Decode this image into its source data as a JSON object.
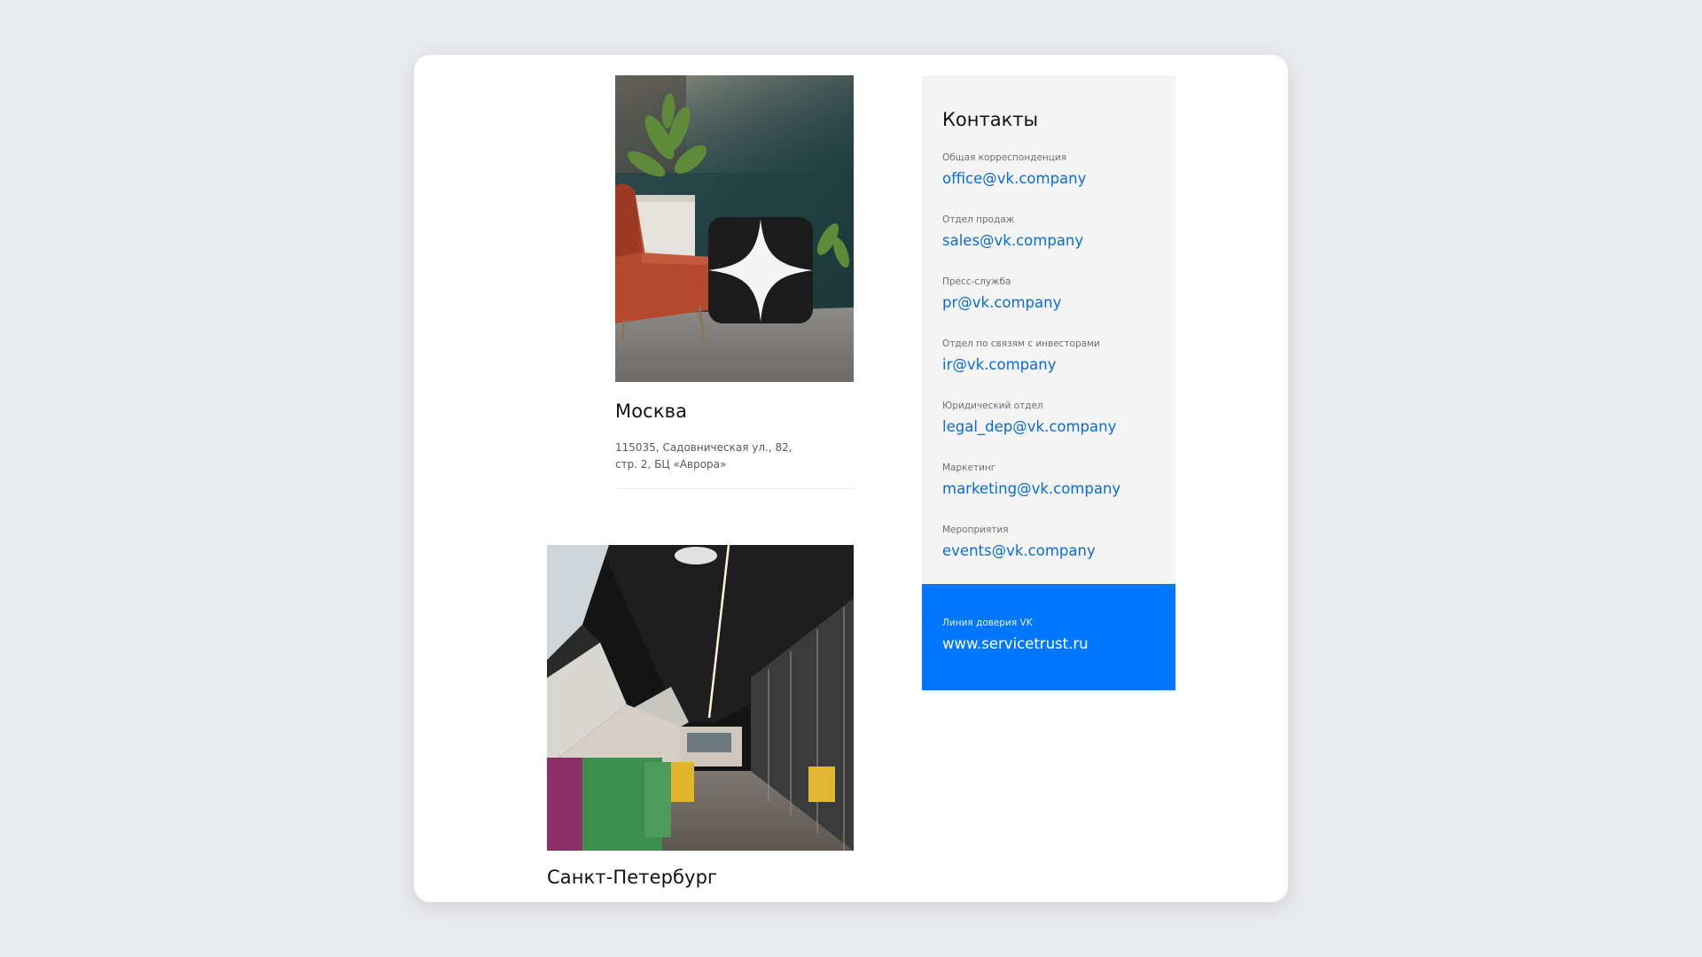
{
  "offices": [
    {
      "city": "Москва",
      "address_line1": "115035, Садовническая ул., 82,",
      "address_line2": "стр. 2, БЦ «Аврора»",
      "photo": "office-lounge-photo"
    },
    {
      "city": "Санкт-Петербург",
      "photo": "office-corridor-photo"
    }
  ],
  "contacts": {
    "title": "Контакты",
    "items": [
      {
        "label": "Общая корреспонденция",
        "email": "office@vk.company"
      },
      {
        "label": "Отдел продаж",
        "email": "sales@vk.company"
      },
      {
        "label": "Пресс-служба",
        "email": "pr@vk.company"
      },
      {
        "label": "Отдел по связям с инвесторами",
        "email": "ir@vk.company"
      },
      {
        "label": "Юридический отдел",
        "email": "legal_dep@vk.company"
      },
      {
        "label": "Маркетинг",
        "email": "marketing@vk.company"
      },
      {
        "label": "Мероприятия",
        "email": "events@vk.company"
      }
    ]
  },
  "trust_line": {
    "label": "Линия доверия VK",
    "url": "www.servicetrust.ru"
  },
  "colors": {
    "accent": "#0077ff",
    "link": "#0a6bd6",
    "panel_bg": "#f4f4f5",
    "page_bg": "#e9eaee"
  }
}
